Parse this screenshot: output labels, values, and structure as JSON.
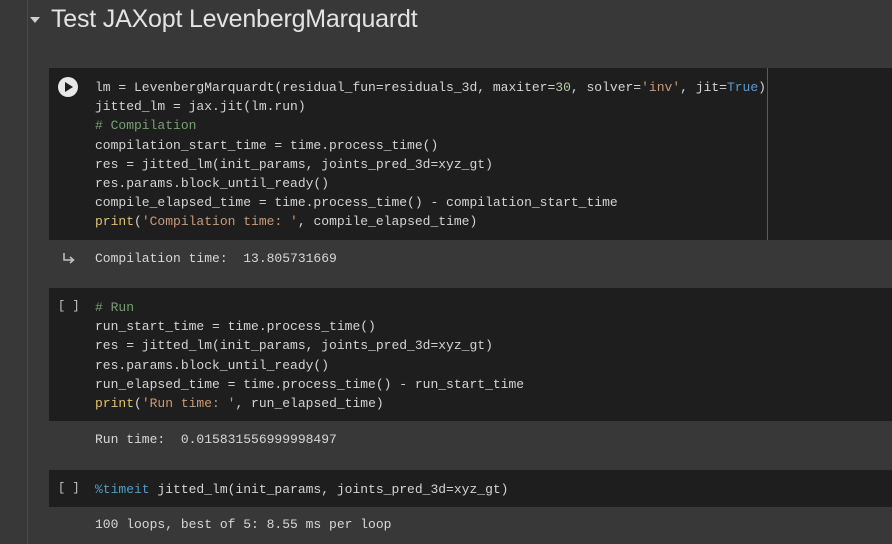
{
  "section": {
    "title": "Test JAXopt LevenbergMarquardt"
  },
  "cells": [
    {
      "exec_count": "",
      "code": [
        "lm = LevenbergMarquardt(residual_fun=residuals_3d, maxiter=30, solver='inv', jit=True)",
        "jitted_lm = jax.jit(lm.run)",
        "# Compilation",
        "compilation_start_time = time.process_time()",
        "res = jitted_lm(init_params, joints_pred_3d=xyz_gt)",
        "res.params.block_until_ready()",
        "compile_elapsed_time = time.process_time() - compilation_start_time",
        "print('Compilation time: ', compile_elapsed_time)"
      ],
      "output": "Compilation time:  13.805731669"
    },
    {
      "exec_count": "[ ]",
      "code": [
        "# Run",
        "run_start_time = time.process_time()",
        "res = jitted_lm(init_params, joints_pred_3d=xyz_gt)",
        "res.params.block_until_ready()",
        "run_elapsed_time = time.process_time() - run_start_time",
        "print('Run time: ', run_elapsed_time)"
      ],
      "output": "Run time:  0.015831556999998497"
    },
    {
      "exec_count": "[ ]",
      "code": [
        "%timeit jitted_lm(init_params, joints_pred_3d=xyz_gt)"
      ],
      "output": "100 loops, best of 5: 8.55 ms per loop"
    }
  ],
  "icons": {
    "run": "play-icon",
    "output": "output-redirect-icon",
    "collapse": "caret-down-icon"
  },
  "colors": {
    "code_bg": "#1e1e1e",
    "page_bg": "#383838",
    "keyword": "#c5a5f5",
    "string": "#cc9a76",
    "comment": "#74a36e"
  }
}
